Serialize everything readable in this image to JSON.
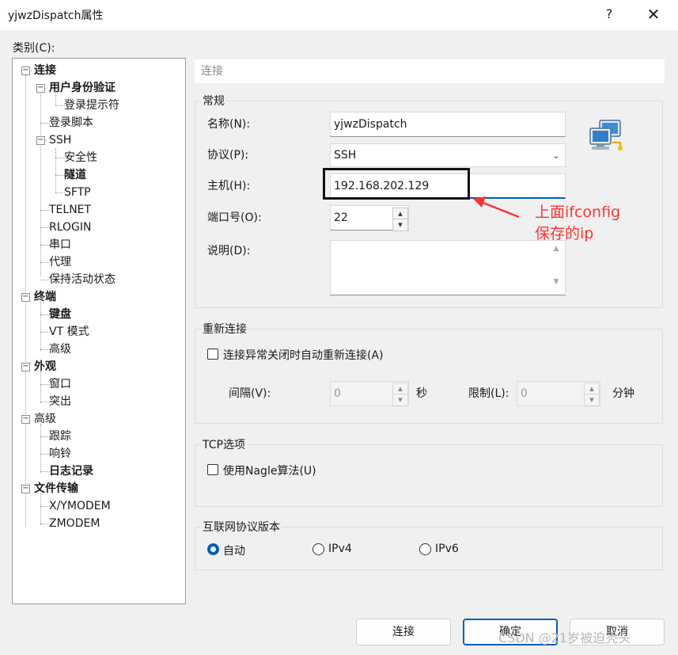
{
  "window": {
    "title": "yjwzDispatch属性",
    "help_label": "?",
    "close_label": "✕"
  },
  "category_label": "类别(C):",
  "tree": {
    "items": [
      {
        "label": "连接",
        "bold": true,
        "toggle": "−"
      },
      {
        "label": "用户身份验证",
        "bold": true,
        "toggle": "−"
      },
      {
        "label": "登录提示符",
        "bold": false
      },
      {
        "label": "登录脚本",
        "bold": false
      },
      {
        "label": "SSH",
        "bold": false,
        "toggle": "−"
      },
      {
        "label": "安全性",
        "bold": false
      },
      {
        "label": "隧道",
        "bold": true
      },
      {
        "label": "SFTP",
        "bold": false
      },
      {
        "label": "TELNET",
        "bold": false
      },
      {
        "label": "RLOGIN",
        "bold": false
      },
      {
        "label": "串口",
        "bold": false
      },
      {
        "label": "代理",
        "bold": false
      },
      {
        "label": "保持活动状态",
        "bold": false
      },
      {
        "label": "终端",
        "bold": true,
        "toggle": "−"
      },
      {
        "label": "键盘",
        "bold": true
      },
      {
        "label": "VT 模式",
        "bold": false
      },
      {
        "label": "高级",
        "bold": false
      },
      {
        "label": "外观",
        "bold": true,
        "toggle": "−"
      },
      {
        "label": "窗口",
        "bold": false
      },
      {
        "label": "突出",
        "bold": false
      },
      {
        "label": "高级",
        "bold": false,
        "toggle": "−"
      },
      {
        "label": "跟踪",
        "bold": false
      },
      {
        "label": "响铃",
        "bold": false
      },
      {
        "label": "日志记录",
        "bold": true
      },
      {
        "label": "文件传输",
        "bold": true,
        "toggle": "−"
      },
      {
        "label": "X/YMODEM",
        "bold": false
      },
      {
        "label": "ZMODEM",
        "bold": false
      }
    ]
  },
  "section_header": "连接",
  "general": {
    "group_title": "常规",
    "name_label": "名称(N):",
    "name_value": "yjwzDispatch",
    "protocol_label": "协议(P):",
    "protocol_value": "SSH",
    "host_label": "主机(H):",
    "host_value": "192.168.202.129",
    "port_label": "端口号(O):",
    "port_value": "22",
    "description_label": "说明(D):",
    "description_value": ""
  },
  "reconnect": {
    "group_title": "重新连接",
    "checkbox_label": "连接异常关闭时自动重新连接(A)",
    "interval_label": "间隔(V):",
    "interval_value": "0",
    "interval_unit": "秒",
    "limit_label": "限制(L):",
    "limit_value": "0",
    "limit_unit": "分钟"
  },
  "tcp": {
    "group_title": "TCP选项",
    "nagle_label": "使用Nagle算法(U)"
  },
  "ip_version": {
    "group_title": "互联网协议版本",
    "options": [
      "自动",
      "IPv4",
      "IPv6"
    ],
    "selected": "自动"
  },
  "annotation": {
    "line1": "上面ifconfig",
    "line2": "保存的ip",
    "color": "#ff3333"
  },
  "buttons": {
    "connect": "连接",
    "ok": "确定",
    "cancel": "取消"
  },
  "watermark": "CSDN @21岁被迫秃头"
}
